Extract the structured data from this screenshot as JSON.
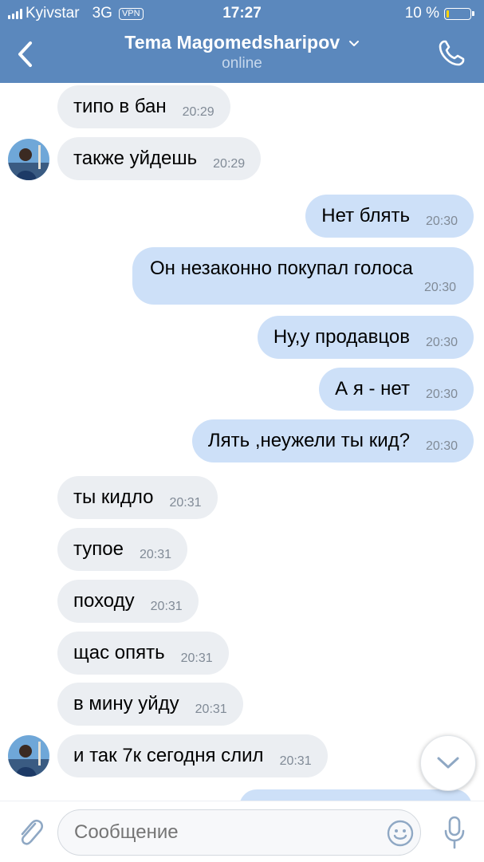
{
  "status_bar": {
    "carrier": "Kyivstar",
    "network": "3G",
    "vpn": "VPN",
    "time": "17:27",
    "battery": "10 %",
    "battery_level": 0.1
  },
  "header": {
    "contact_name": "Tema Magomedsharipov",
    "presence": "online",
    "icons": {
      "back": "chevron-left-icon",
      "call": "phone-icon",
      "expand": "chevron-down-icon"
    }
  },
  "messages": [
    {
      "dir": "in",
      "text": "типо в бан",
      "time": "20:29"
    },
    {
      "dir": "in",
      "text": "также уйдешь",
      "time": "20:29",
      "avatar": true
    },
    {
      "dir": "out",
      "text": "Нет блять",
      "time": "20:30"
    },
    {
      "dir": "out",
      "text": "Он незаконно покупал голоса",
      "time": "20:30"
    },
    {
      "dir": "out",
      "text": "Ну,у продавцов",
      "time": "20:30"
    },
    {
      "dir": "out",
      "text": "А я - нет",
      "time": "20:30"
    },
    {
      "dir": "out",
      "text": "Лять ,неужели ты кид?",
      "time": "20:30"
    },
    {
      "dir": "in",
      "text": "ты кидло",
      "time": "20:31"
    },
    {
      "dir": "in",
      "text": "тупое",
      "time": "20:31"
    },
    {
      "dir": "in",
      "text": "походу",
      "time": "20:31"
    },
    {
      "dir": "in",
      "text": "щас опять",
      "time": "20:31"
    },
    {
      "dir": "in",
      "text": "в мину уйду",
      "time": "20:31"
    },
    {
      "dir": "in",
      "text": "и так 7к сегодня слил",
      "time": "20:31",
      "avatar": true
    }
  ],
  "composer": {
    "placeholder": "Сообщение",
    "icons": {
      "attach": "paperclip-icon",
      "emoji": "smiley-icon",
      "mic": "microphone-icon",
      "scroll": "chevron-down-icon"
    }
  },
  "colors": {
    "header_bg": "#5b88bd",
    "incoming_bubble": "#ebeef2",
    "outgoing_bubble": "#cde0f8",
    "accent_icon": "#8fa8c4",
    "time_text": "#808a96"
  }
}
